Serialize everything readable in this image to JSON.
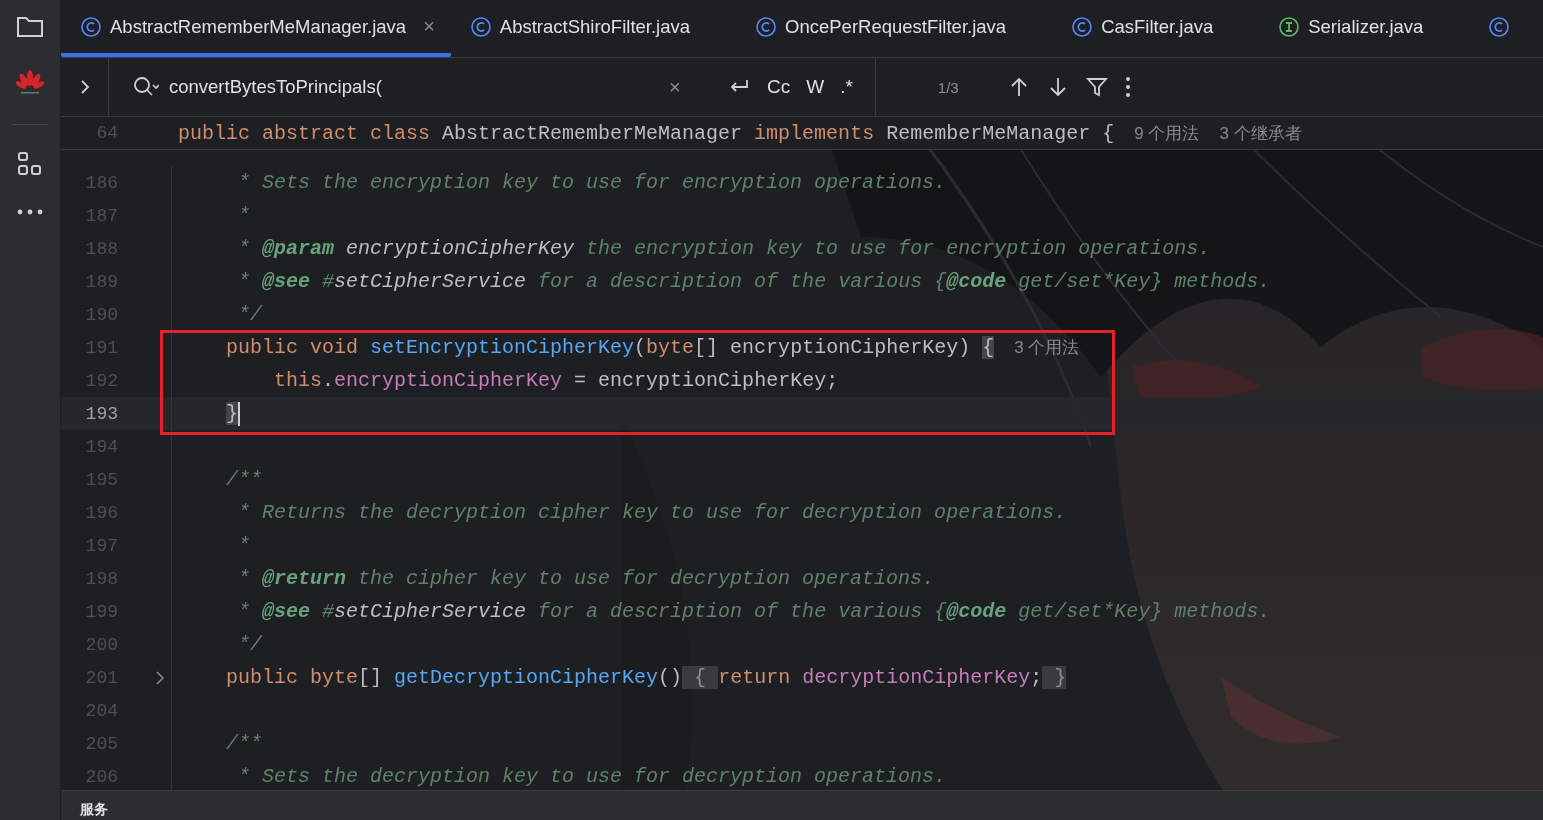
{
  "sidebar": {
    "items": [
      {
        "kind": "folder"
      },
      {
        "kind": "logo"
      },
      {
        "kind": "structure"
      },
      {
        "kind": "more"
      }
    ]
  },
  "tabs": [
    {
      "kind": "class",
      "label": "AbstractRememberMeManager.java",
      "selected": true,
      "close": "×"
    },
    {
      "kind": "class",
      "label": "AbstractShiroFilter.java",
      "selected": false
    },
    {
      "kind": "class",
      "label": "OncePerRequestFilter.java",
      "selected": false
    },
    {
      "kind": "class",
      "label": "CasFilter.java",
      "selected": false
    },
    {
      "kind": "interface",
      "label": "Serializer.java",
      "selected": false
    },
    {
      "kind": "class",
      "selected": false
    }
  ],
  "search": {
    "value": "convertBytesToPrincipals(",
    "clear": "×",
    "options": [
      {
        "kind": "newline"
      },
      {
        "kind": "text",
        "label": "Cc"
      },
      {
        "kind": "text",
        "label": "W"
      },
      {
        "kind": "text",
        "label": ".*"
      }
    ],
    "count": "1/3"
  },
  "sticky_header": {
    "number": "64",
    "tokens": [
      {
        "kind": "kw",
        "t": "public abstract class "
      },
      {
        "kind": "plain",
        "t": "AbstractRememberMeManager "
      },
      {
        "kind": "kw",
        "t": "implements "
      },
      {
        "kind": "plain",
        "t": "RememberMeManager {"
      }
    ],
    "hints": [
      "9 个用法",
      "3 个继承者"
    ]
  },
  "lines": [
    {
      "number": "186",
      "current": false,
      "boxed": false,
      "folded": false,
      "tokens": [
        {
          "kind": "doc",
          "t": "     * Sets the encryption key to use for encryption operations."
        }
      ]
    },
    {
      "number": "187",
      "current": false,
      "boxed": false,
      "folded": false,
      "tokens": [
        {
          "kind": "doc",
          "t": "     *"
        }
      ]
    },
    {
      "number": "188",
      "current": false,
      "boxed": false,
      "folded": false,
      "tokens": [
        {
          "kind": "doc",
          "t": "     * "
        },
        {
          "kind": "tag",
          "t": "@param"
        },
        {
          "kind": "ref",
          "t": " encryptionCipherKey"
        },
        {
          "kind": "doc",
          "t": " the encryption key to use for encryption operations."
        }
      ]
    },
    {
      "number": "189",
      "current": false,
      "boxed": false,
      "folded": false,
      "tokens": [
        {
          "kind": "doc",
          "t": "     * "
        },
        {
          "kind": "tag",
          "t": "@see"
        },
        {
          "kind": "doc",
          "t": " #"
        },
        {
          "kind": "ref",
          "t": "setCipherService"
        },
        {
          "kind": "doc",
          "t": " for a description of the various {"
        },
        {
          "kind": "tag",
          "t": "@code"
        },
        {
          "kind": "doc",
          "t": " get/set*Key} methods."
        }
      ]
    },
    {
      "number": "190",
      "current": false,
      "boxed": false,
      "folded": false,
      "tokens": [
        {
          "kind": "doc",
          "t": "     */"
        }
      ]
    },
    {
      "number": "191",
      "current": false,
      "boxed": true,
      "folded": false,
      "tokens": [
        {
          "kind": "kw",
          "t": "    public void "
        },
        {
          "kind": "fn",
          "t": "setEncryptionCipherKey"
        },
        {
          "kind": "plain",
          "t": "("
        },
        {
          "kind": "kw",
          "t": "byte"
        },
        {
          "kind": "plain",
          "t": "[] encryptionCipherKey) "
        },
        {
          "kind": "brace",
          "t": "{"
        }
      ],
      "hints": [
        "3 个用法"
      ]
    },
    {
      "number": "192",
      "current": false,
      "boxed": true,
      "folded": false,
      "tokens": [
        {
          "kind": "kw",
          "t": "        this"
        },
        {
          "kind": "plain",
          "t": "."
        },
        {
          "kind": "field",
          "t": "encryptionCipherKey"
        },
        {
          "kind": "plain",
          "t": " = encryptionCipherKey;"
        }
      ]
    },
    {
      "number": "193",
      "current": true,
      "boxed": true,
      "folded": false,
      "tokens": [
        {
          "kind": "brace",
          "t": "    }"
        }
      ]
    },
    {
      "number": "194",
      "current": false,
      "boxed": false,
      "folded": false
    },
    {
      "number": "195",
      "current": false,
      "boxed": false,
      "folded": false,
      "tokens": [
        {
          "kind": "doc",
          "t": "    /**"
        }
      ]
    },
    {
      "number": "196",
      "current": false,
      "boxed": false,
      "folded": false,
      "tokens": [
        {
          "kind": "doc",
          "t": "     * Returns the decryption cipher key to use for decryption operations."
        }
      ]
    },
    {
      "number": "197",
      "current": false,
      "boxed": false,
      "folded": false,
      "tokens": [
        {
          "kind": "doc",
          "t": "     *"
        }
      ]
    },
    {
      "number": "198",
      "current": false,
      "boxed": false,
      "folded": false,
      "tokens": [
        {
          "kind": "doc",
          "t": "     * "
        },
        {
          "kind": "tag",
          "t": "@return"
        },
        {
          "kind": "doc",
          "t": " the cipher key to use for decryption operations."
        }
      ]
    },
    {
      "number": "199",
      "current": false,
      "boxed": false,
      "folded": false,
      "tokens": [
        {
          "kind": "doc",
          "t": "     * "
        },
        {
          "kind": "tag",
          "t": "@see"
        },
        {
          "kind": "doc",
          "t": " #"
        },
        {
          "kind": "ref",
          "t": "setCipherService"
        },
        {
          "kind": "doc",
          "t": " for a description of the various {"
        },
        {
          "kind": "tag",
          "t": "@code"
        },
        {
          "kind": "doc",
          "t": " get/set*Key} methods."
        }
      ]
    },
    {
      "number": "200",
      "current": false,
      "boxed": false,
      "folded": false,
      "tokens": [
        {
          "kind": "doc",
          "t": "     */"
        }
      ]
    },
    {
      "number": "201",
      "current": false,
      "boxed": false,
      "folded": true,
      "tokens": [
        {
          "kind": "kw",
          "t": "    public byte"
        },
        {
          "kind": "plain",
          "t": "[] "
        },
        {
          "kind": "fn",
          "t": "getDecryptionCipherKey"
        },
        {
          "kind": "plain",
          "t": "()"
        },
        {
          "kind": "fold",
          "t": " { "
        },
        {
          "kind": "kw",
          "t": "return "
        },
        {
          "kind": "field",
          "t": "decryptionCipherKey"
        },
        {
          "kind": "plain",
          "t": ";"
        },
        {
          "kind": "fold",
          "t": " }"
        }
      ]
    },
    {
      "number": "204",
      "current": false,
      "boxed": false,
      "folded": false
    },
    {
      "number": "205",
      "current": false,
      "boxed": false,
      "folded": false,
      "tokens": [
        {
          "kind": "doc",
          "t": "    /**"
        }
      ]
    },
    {
      "number": "206",
      "current": false,
      "boxed": false,
      "folded": false,
      "tokens": [
        {
          "kind": "doc",
          "t": "     * Sets the decryption key to use for decryption operations."
        }
      ]
    }
  ],
  "bottom_panel": {
    "title": "服务"
  }
}
